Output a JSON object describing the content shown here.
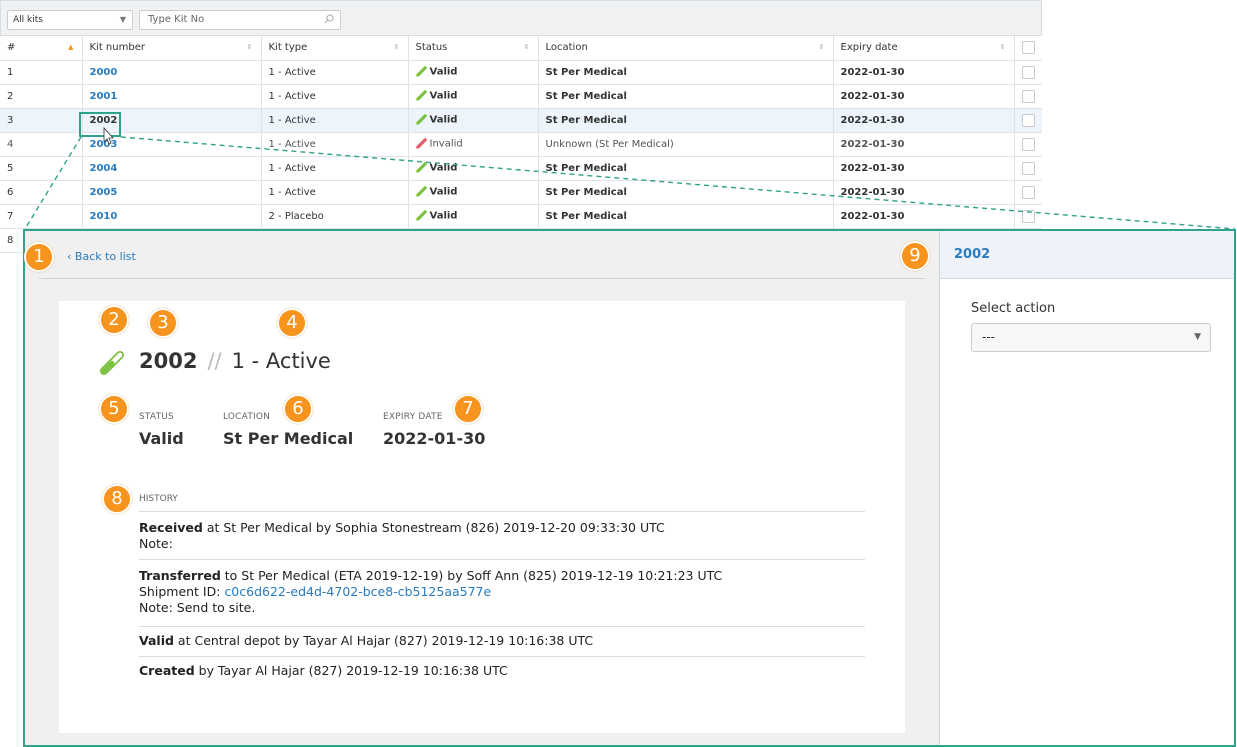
{
  "toolbar": {
    "kit_filter": "All kits",
    "search_placeholder": "Type Kit No"
  },
  "table": {
    "columns": [
      "#",
      "Kit number",
      "Kit type",
      "Status",
      "Location",
      "Expiry date"
    ],
    "rows": [
      {
        "idx": "1",
        "kit": "2000",
        "type": "1 - Active",
        "status": "Valid",
        "location": "St Per Medical",
        "expiry": "2022-01-30"
      },
      {
        "idx": "2",
        "kit": "2001",
        "type": "1 - Active",
        "status": "Valid",
        "location": "St Per Medical",
        "expiry": "2022-01-30"
      },
      {
        "idx": "3",
        "kit": "2002",
        "type": "1 - Active",
        "status": "Valid",
        "location": "St Per Medical",
        "expiry": "2022-01-30"
      },
      {
        "idx": "4",
        "kit": "2003",
        "type": "1 - Active",
        "status": "Invalid",
        "location": "Unknown (St Per Medical)",
        "expiry": "2022-01-30"
      },
      {
        "idx": "5",
        "kit": "2004",
        "type": "1 - Active",
        "status": "Valid",
        "location": "St Per Medical",
        "expiry": "2022-01-30"
      },
      {
        "idx": "6",
        "kit": "2005",
        "type": "1 - Active",
        "status": "Valid",
        "location": "St Per Medical",
        "expiry": "2022-01-30"
      },
      {
        "idx": "7",
        "kit": "2010",
        "type": "2 - Placebo",
        "status": "Valid",
        "location": "St Per Medical",
        "expiry": "2022-01-30"
      },
      {
        "idx": "8",
        "kit": "",
        "type": "",
        "status": "",
        "location": "",
        "expiry": ""
      }
    ]
  },
  "detail": {
    "back_label": "Back to list",
    "kit_number": "2002",
    "separator": "//",
    "kit_type": "1 - Active",
    "status_label": "STATUS",
    "status_value": "Valid",
    "location_label": "LOCATION",
    "location_value": "St Per Medical",
    "expiry_label": "EXPIRY DATE",
    "expiry_value": "2022-01-30",
    "history_label": "HISTORY",
    "history": [
      {
        "action": "Received",
        "text": " at St Per Medical by Sophia Stonestream (826) 2019-12-20 09:33:30 UTC",
        "line2": "Note:"
      },
      {
        "action": "Transferred",
        "text": " to St Per Medical (ETA 2019-12-19) by Soff Ann (825) 2019-12-19 10:21:23 UTC",
        "line2_prefix": "Shipment ID: ",
        "line2_link": "c0c6d622-ed4d-4702-bce8-cb5125aa577e",
        "line3": "Note: Send to site."
      },
      {
        "action": "Valid",
        "text": " at Central depot by Tayar Al Hajar (827) 2019-12-19 10:16:38 UTC"
      },
      {
        "action": "Created",
        "text": " by Tayar Al Hajar (827) 2019-12-19 10:16:38 UTC"
      }
    ]
  },
  "side": {
    "title": "2002",
    "select_label": "Select action",
    "select_value": "---"
  },
  "badges": [
    "1",
    "2",
    "3",
    "4",
    "5",
    "6",
    "7",
    "8",
    "9"
  ],
  "colors": {
    "accent_green": "#2ea28b",
    "badge_orange": "#f7941d",
    "link_blue": "#2a7bbf",
    "valid_pill": "#7cc242",
    "invalid_pill": "#e25b6b"
  }
}
